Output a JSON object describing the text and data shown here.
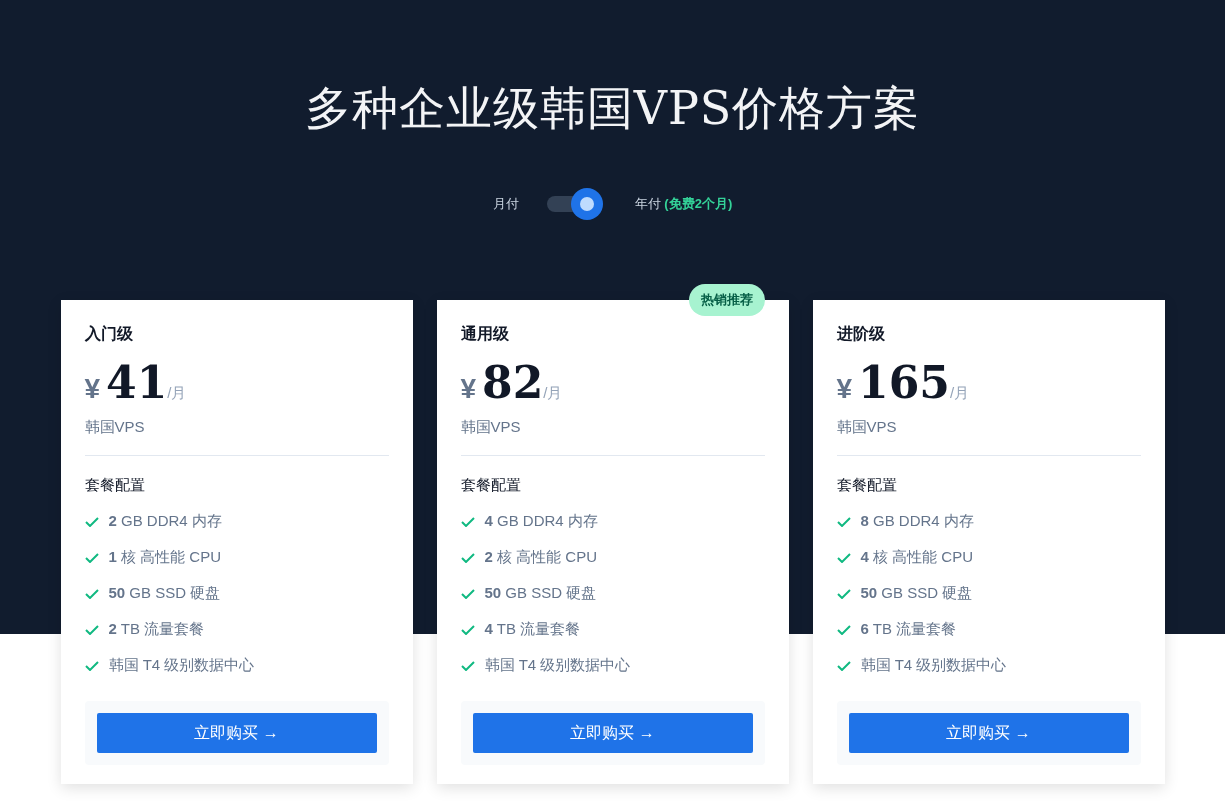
{
  "title": "多种企业级韩国VPS价格方案",
  "billing": {
    "monthly_label": "月付",
    "annual_label": "年付",
    "annual_note": "(免费2个月)",
    "annual_selected": true
  },
  "plans": [
    {
      "name": "入门级",
      "currency": "¥",
      "price": "41",
      "period": "/月",
      "product": "韩国VPS",
      "config_title": "套餐配置",
      "features": [
        "**2** GB DDR4 内存",
        "**1** 核 高性能 CPU",
        "**50** GB SSD 硬盘",
        "**2** TB 流量套餐",
        "韩国 T4 级别数据中心"
      ],
      "button": "立即购买 →"
    },
    {
      "name": "通用级",
      "currency": "¥",
      "price": "82",
      "period": "/月",
      "product": "韩国VPS",
      "badge": "热销推荐",
      "config_title": "套餐配置",
      "features": [
        "**4** GB DDR4 内存",
        "**2** 核 高性能 CPU",
        "**50** GB SSD 硬盘",
        "**4** TB 流量套餐",
        "韩国 T4 级别数据中心"
      ],
      "button": "立即购买 →"
    },
    {
      "name": "进阶级",
      "currency": "¥",
      "price": "165",
      "period": "/月",
      "product": "韩国VPS",
      "config_title": "套餐配置",
      "features": [
        "**8** GB DDR4 内存",
        "**4** 核 高性能 CPU",
        "**50** GB SSD 硬盘",
        "**6** TB 流量套餐",
        "韩国 T4 级别数据中心"
      ],
      "button": "立即购买 →"
    }
  ]
}
